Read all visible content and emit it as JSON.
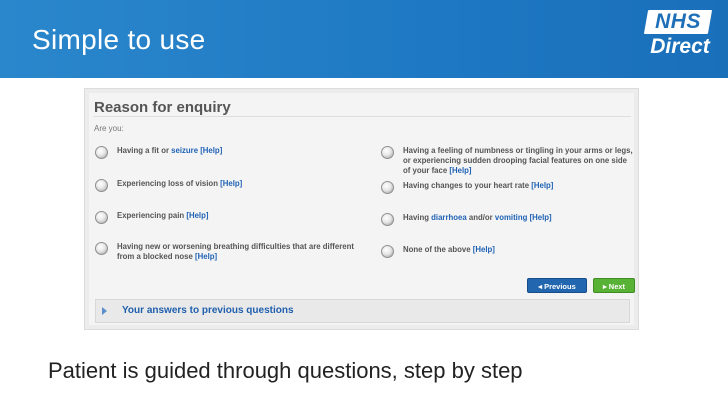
{
  "slide": {
    "title": "Simple to use",
    "logo": {
      "line1": "NHS",
      "line2": "Direct"
    },
    "caption": "Patient is guided through questions, step by step"
  },
  "form": {
    "title": "Reason for enquiry",
    "prompt": "Are you:",
    "help_label": "[Help]",
    "options": [
      {
        "pre": "Having a fit or ",
        "link": "seizure",
        "post": ""
      },
      {
        "pre": "Experiencing loss of vision",
        "link": "",
        "post": ""
      },
      {
        "pre": "Experiencing pain",
        "link": "",
        "post": ""
      },
      {
        "pre": "Having new or worsening breathing difficulties that are different from a blocked nose",
        "link": "",
        "post": ""
      },
      {
        "pre": "Having a feeling of numbness or tingling in your arms or legs, or experiencing sudden drooping facial features on one side of your face",
        "link": "",
        "post": ""
      },
      {
        "pre": "Having changes to your heart rate",
        "link": "",
        "post": ""
      },
      {
        "pre": "Having ",
        "link": "diarrhoea",
        "mid": " and/or ",
        "link2": "vomiting",
        "post": ""
      },
      {
        "pre": "None of the above",
        "link": "",
        "post": ""
      }
    ],
    "previous_label": "◂ Previous",
    "next_label": "▸ Next",
    "accordion_label": "Your answers to previous questions"
  },
  "colors": {
    "banner": "#1e78c3",
    "link": "#1f62b5",
    "previous_button": "#2266b0",
    "next_button": "#58b236"
  },
  "icons": {
    "radio": "radio-button-icon",
    "accordion": "triangle-right-icon"
  }
}
